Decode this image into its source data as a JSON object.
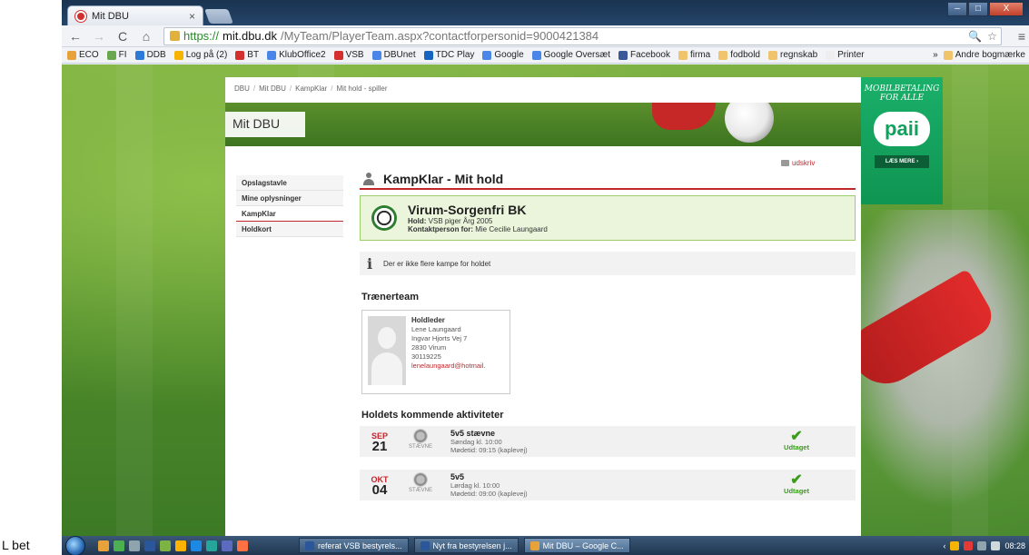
{
  "caption": "L bet",
  "browser": {
    "tab_title": "Mit DBU",
    "tab_close": "×",
    "url_scheme": "https://",
    "url_host": "mit.dbu.dk",
    "url_path": "/MyTeam/PlayerTeam.aspx?contactforpersonid=9000421384",
    "nav": {
      "back": "←",
      "forward": "→",
      "reload": "C",
      "home": "⌂",
      "menu": "≡"
    },
    "omni_icons": {
      "zoom": "🔍",
      "star": "☆"
    },
    "window_buttons": {
      "minimize": "–",
      "maximize": "□",
      "close": "X"
    },
    "bookmarks": [
      {
        "label": "ECO",
        "color": "#e8a23a"
      },
      {
        "label": "FI",
        "color": "#6aa84f"
      },
      {
        "label": "DDB",
        "color": "#2d7bd6"
      },
      {
        "label": "Log på (2)",
        "color": "#f4b400"
      },
      {
        "label": "BT",
        "color": "#d32f2f"
      },
      {
        "label": "KlubOffice2",
        "color": "#4a86e8"
      },
      {
        "label": "VSB",
        "color": "#d32f2f"
      },
      {
        "label": "DBUnet",
        "color": "#4a86e8"
      },
      {
        "label": "TDC Play",
        "color": "#1565c0"
      },
      {
        "label": "Google",
        "color": "#4a86e8"
      },
      {
        "label": "Google Oversæt",
        "color": "#4a86e8"
      },
      {
        "label": "Facebook",
        "color": "#3b5998"
      },
      {
        "label": "firma",
        "color": "#f0c36d"
      },
      {
        "label": "fodbold",
        "color": "#f0c36d"
      },
      {
        "label": "regnskab",
        "color": "#f0c36d"
      },
      {
        "label": "Printer",
        "color": "#eeeeee"
      }
    ],
    "bookmarks_overflow": "»",
    "other_bookmarks": "Andre bogmærke"
  },
  "site": {
    "breadcrumb": [
      "DBU",
      "Mit DBU",
      "KampKlar",
      "Mit hold - spiller"
    ],
    "brand": "Mit DBU",
    "print_label": "udskriv",
    "nav": [
      "Opslagstavle",
      "Mine oplysninger",
      "KampKlar",
      "Holdkort"
    ],
    "active_nav": "KampKlar",
    "page_title": "KampKlar - Mit hold",
    "club": {
      "name": "Virum-Sorgenfri BK",
      "team_label": "Hold:",
      "team": "VSB piger Årg 2005",
      "contact_label": "Kontaktperson for:",
      "contact": "Mie Cecilie Laungaard"
    },
    "info_text": "Der er ikke flere kampe for holdet",
    "info_icon": "i",
    "coaches_title": "Trænerteam",
    "coach": {
      "role": "Holdleder",
      "name": "Lene Laungaard",
      "address": "Ingvar Hjorts Vej 7",
      "city": "2830 Virum",
      "phone": "30119225",
      "email": "lenelaungaard@hotmail."
    },
    "activities_title": "Holdets kommende aktiviteter",
    "activities": [
      {
        "month": "SEP",
        "day": "21",
        "type": "STÆVNE",
        "name": "5v5 stævne",
        "time": "Søndag kl. 10:00",
        "meet": "Mødetid: 09:15 (kaplevej)",
        "status": "Udtaget",
        "check": "✔"
      },
      {
        "month": "OKT",
        "day": "04",
        "type": "STÆVNE",
        "name": "5v5",
        "time": "Lørdag kl. 10:00",
        "meet": "Mødetid: 09:00 (kaplevej)",
        "status": "Udtaget",
        "check": "✔"
      }
    ]
  },
  "ad": {
    "tagline": "MOBILBETALING FOR ALLE",
    "logo": "paii",
    "cta": "LÆS MERE ›"
  },
  "taskbar": {
    "windows": [
      {
        "label": "referat VSB bestyrels...",
        "color": "#2b579a"
      },
      {
        "label": "Nyt fra bestyrelsen j...",
        "color": "#2b579a"
      },
      {
        "label": "Mit DBU – Google C...",
        "color": "#e8a23a"
      }
    ],
    "tray_left": "‹",
    "clock": "08:28"
  }
}
